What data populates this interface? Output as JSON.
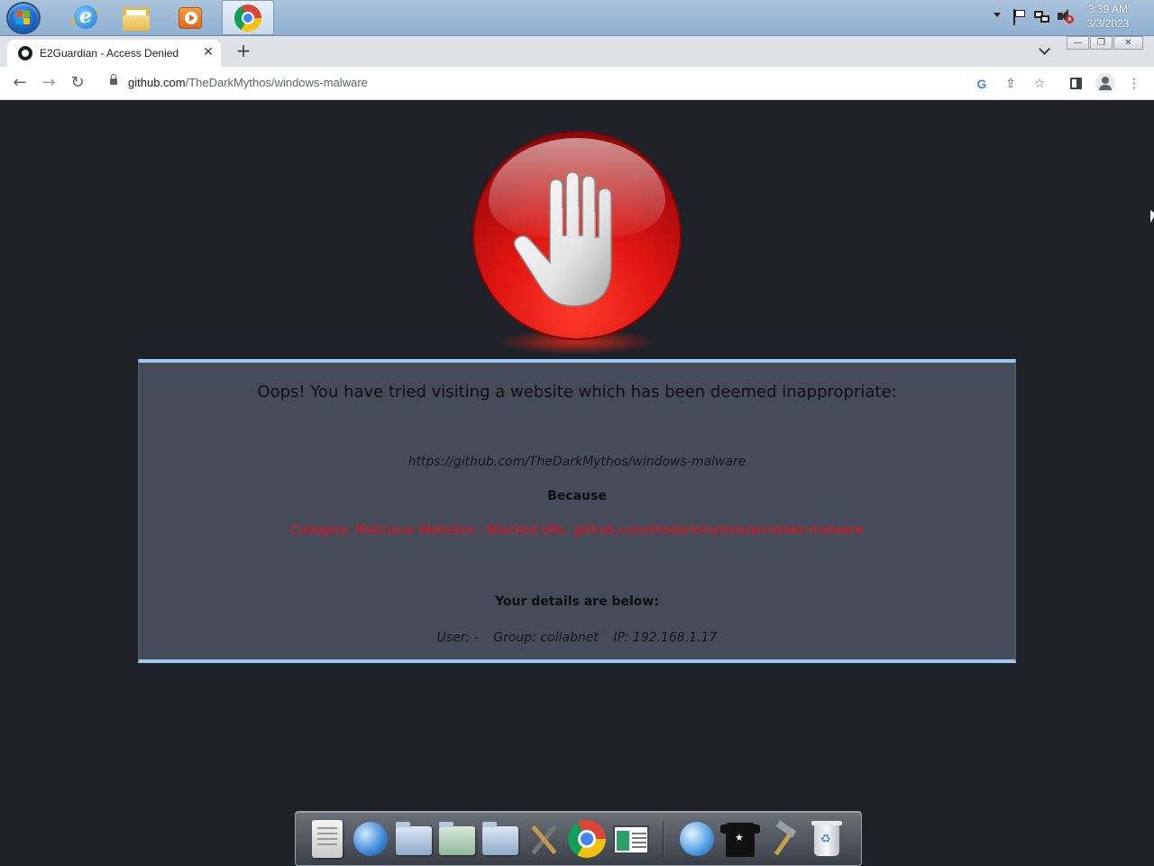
{
  "taskbar": {
    "clock_time": "3:39 AM",
    "clock_date": "3/3/2023",
    "apps": [
      "start-orb",
      "internet-explorer-icon",
      "file-explorer-icon",
      "media-player-icon",
      "chrome-icon"
    ]
  },
  "browser": {
    "tab_title": "E2Guardian - Access Denied",
    "tab_close": "✕",
    "new_tab": "+",
    "url_host": "github.com",
    "url_path": "/TheDarkMythos/windows-malware",
    "back": "←",
    "forward": "→",
    "reload": "↻",
    "more": "⋮"
  },
  "page": {
    "headline": "Oops! You have tried visiting a website which has been deemed inappropriate:",
    "blocked_url": "https://github.com/TheDarkMythos/windows-malware",
    "because_label": "Because",
    "reason": "Category: Malicious Websites - Blocked URL: github.com/thedarkmythos/windows-malware",
    "details_heading": "Your details are below:",
    "user": "User: -",
    "group": "Group: collabnet",
    "ip": "IP: 192.168.1.17"
  },
  "colors": {
    "page_background": "#1f2128",
    "box_background": "#464b5a",
    "box_border": "#9ac8f0",
    "reason_text": "#e3101a",
    "stop_red": "#e01512"
  },
  "dock": {
    "items": [
      "text-editor-icon",
      "network-globe-icon",
      "documents-folder-icon",
      "scripts-folder-icon",
      "images-folder-icon",
      "tools-icon",
      "chrome-icon",
      "window-manager-icon",
      "internet-globe-icon",
      "tshirt-icon",
      "hammer-icon",
      "trash-icon"
    ]
  }
}
